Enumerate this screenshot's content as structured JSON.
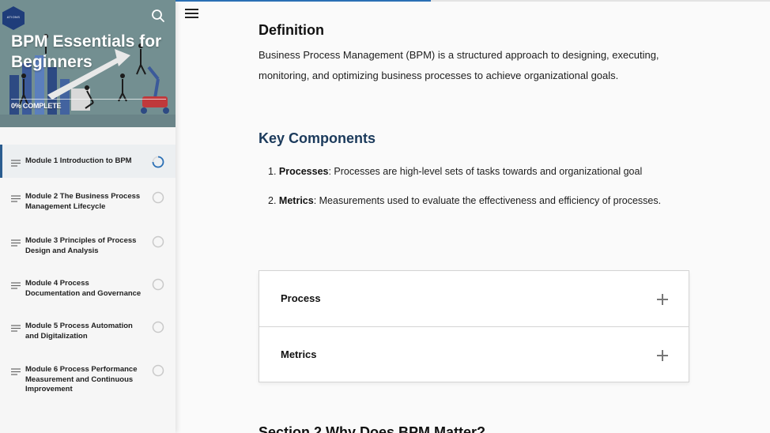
{
  "course": {
    "title": "BPM Essentials for Beginners",
    "logo_text": "ATIONS",
    "progress_label": "0% COMPLETE",
    "progress_fraction": 0
  },
  "lesson_progress_fraction": 0.43,
  "modules": [
    {
      "label": "Module 1 Introduction to BPM",
      "status": "in-progress"
    },
    {
      "label": "Module 2 The Business Process Management Lifecycle",
      "status": "not-started"
    },
    {
      "label": "Module 3 Principles of Process Design and Analysis",
      "status": "not-started"
    },
    {
      "label": "Module 4 Process Documentation and Governance",
      "status": "not-started"
    },
    {
      "label": "Module 5 Process Automation and Digitalization",
      "status": "not-started"
    },
    {
      "label": "Module 6 Process Performance Measurement and Continuous Improvement",
      "status": "not-started"
    }
  ],
  "content": {
    "definition_heading": "Definition",
    "definition_text": "Business Process Management (BPM) is a structured approach to designing, executing, monitoring, and optimizing business processes to achieve organizational goals.",
    "key_components_heading": "Key Components",
    "components": [
      {
        "num": "1.",
        "term": "Processes",
        "text": ": Processes are high-level sets of tasks towards and organizational goal"
      },
      {
        "num": "2.",
        "term": "Metrics",
        "text": ": Measurements used to evaluate the effectiveness and efficiency of processes."
      }
    ],
    "accordion": [
      {
        "title": "Process"
      },
      {
        "title": "Metrics"
      }
    ],
    "next_heading": "Section 2 Why Does BPM Matter?"
  },
  "colors": {
    "accent": "#2a6fb5",
    "heading_blue": "#1b3a5b",
    "banner": "#6f8a8e"
  },
  "icons": {
    "logo": "hexagon-logo-icon",
    "search": "search-icon",
    "menu": "hamburger-menu-icon",
    "module_lines": "lines-icon",
    "status_in_progress": "progress-ring-icon",
    "status_not_started": "empty-circle-icon",
    "expand": "plus-icon"
  }
}
